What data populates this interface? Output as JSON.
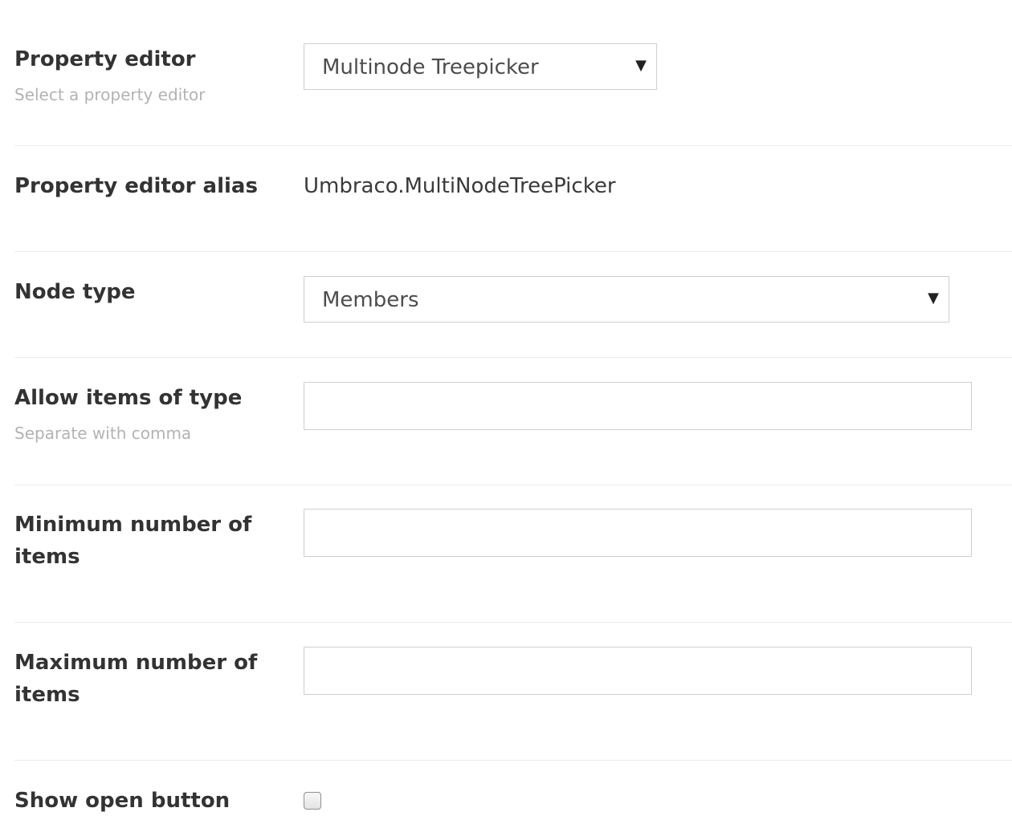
{
  "property_editor": {
    "label": "Property editor",
    "description": "Select a property editor",
    "selected": "Multinode Treepicker"
  },
  "property_editor_alias": {
    "label": "Property editor alias",
    "value": "Umbraco.MultiNodeTreePicker"
  },
  "node_type": {
    "label": "Node type",
    "selected": "Members"
  },
  "allow_items_of_type": {
    "label": "Allow items of type",
    "description": "Separate with comma",
    "value": ""
  },
  "minimum_items": {
    "label": "Minimum number of items",
    "value": ""
  },
  "maximum_items": {
    "label": "Maximum number of items",
    "value": ""
  },
  "show_open_button": {
    "label": "Show open button",
    "checked": false
  },
  "icons": {
    "dropdown_caret": "▼"
  }
}
